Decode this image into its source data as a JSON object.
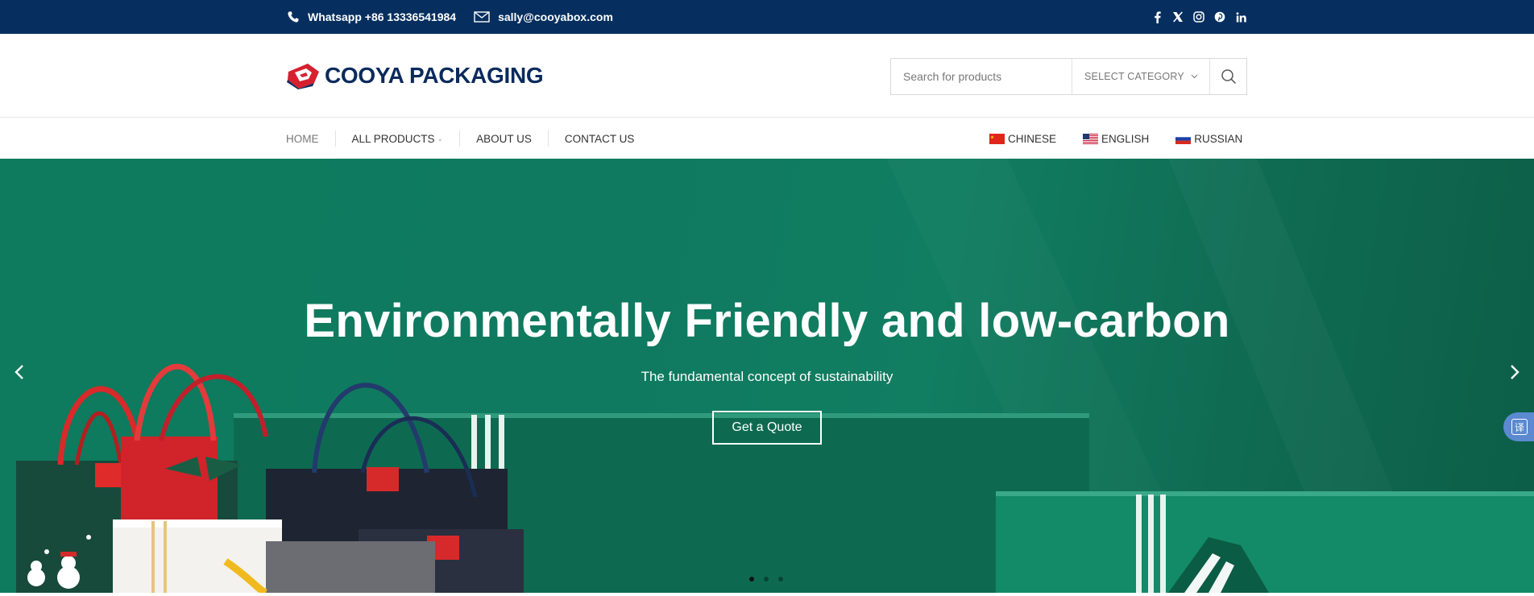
{
  "topbar": {
    "whatsapp": "Whatsapp +86 13336541984",
    "email": "sally@cooyabox.com",
    "social_icons": [
      "facebook-icon",
      "x-twitter-icon",
      "instagram-icon",
      "pinterest-icon",
      "linkedin-icon"
    ]
  },
  "header": {
    "logo_text": "COOYA PACKAGING",
    "search": {
      "placeholder": "Search for products",
      "category_label": "SELECT CATEGORY"
    }
  },
  "nav": {
    "items": [
      {
        "label": "Home"
      },
      {
        "label": "All Products",
        "has_dropdown": true
      },
      {
        "label": "About Us"
      },
      {
        "label": "Contact Us"
      }
    ],
    "languages": [
      {
        "label": "Chinese",
        "flag": "cn-flag-icon"
      },
      {
        "label": "English",
        "flag": "us-flag-icon"
      },
      {
        "label": "Russian",
        "flag": "ru-flag-icon"
      }
    ]
  },
  "hero": {
    "title": "Environmentally Friendly and low-carbon",
    "subtitle": "The fundamental concept of sustainability",
    "cta": "Get a Quote",
    "slide_count": 3,
    "active_slide": 1
  },
  "translate_button": {
    "label": "译"
  },
  "colors": {
    "topbar_bg": "#062f5f",
    "brand_navy": "#0b2a5b",
    "brand_red": "#d62030",
    "hero_green": "#0f7a5f"
  }
}
